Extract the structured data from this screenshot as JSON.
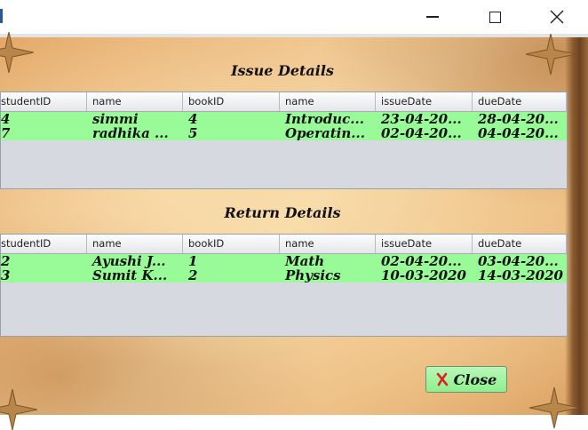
{
  "window": {
    "controls": [
      "minimize-icon",
      "maximize-icon",
      "close-icon"
    ]
  },
  "issue": {
    "title": "Issue Details",
    "columns": [
      "studentID",
      "name",
      "bookID",
      "name",
      "issueDate",
      "dueDate"
    ],
    "rows": [
      [
        "4",
        "simmi",
        "4",
        "Introduc...",
        "23-04-20...",
        "28-04-20..."
      ],
      [
        "7",
        "radhika ...",
        "5",
        "Operatin...",
        "02-04-20...",
        "04-04-20..."
      ]
    ]
  },
  "return": {
    "title": "Return Details",
    "columns": [
      "studentID",
      "name",
      "bookID",
      "name",
      "issueDate",
      "dueDate"
    ],
    "rows": [
      [
        "2",
        "Ayushi J...",
        "1",
        "Math",
        "02-04-20...",
        "03-04-20..."
      ],
      [
        "3",
        "Sumit K...",
        "2",
        "Physics",
        "10-03-2020",
        "14-03-2020"
      ]
    ]
  },
  "close_button": {
    "label": "Close",
    "icon": "x-icon"
  },
  "colors": {
    "row_highlight": "#98fb98",
    "table_bg": "#d6d9e0",
    "close_icon": "#e02020"
  }
}
